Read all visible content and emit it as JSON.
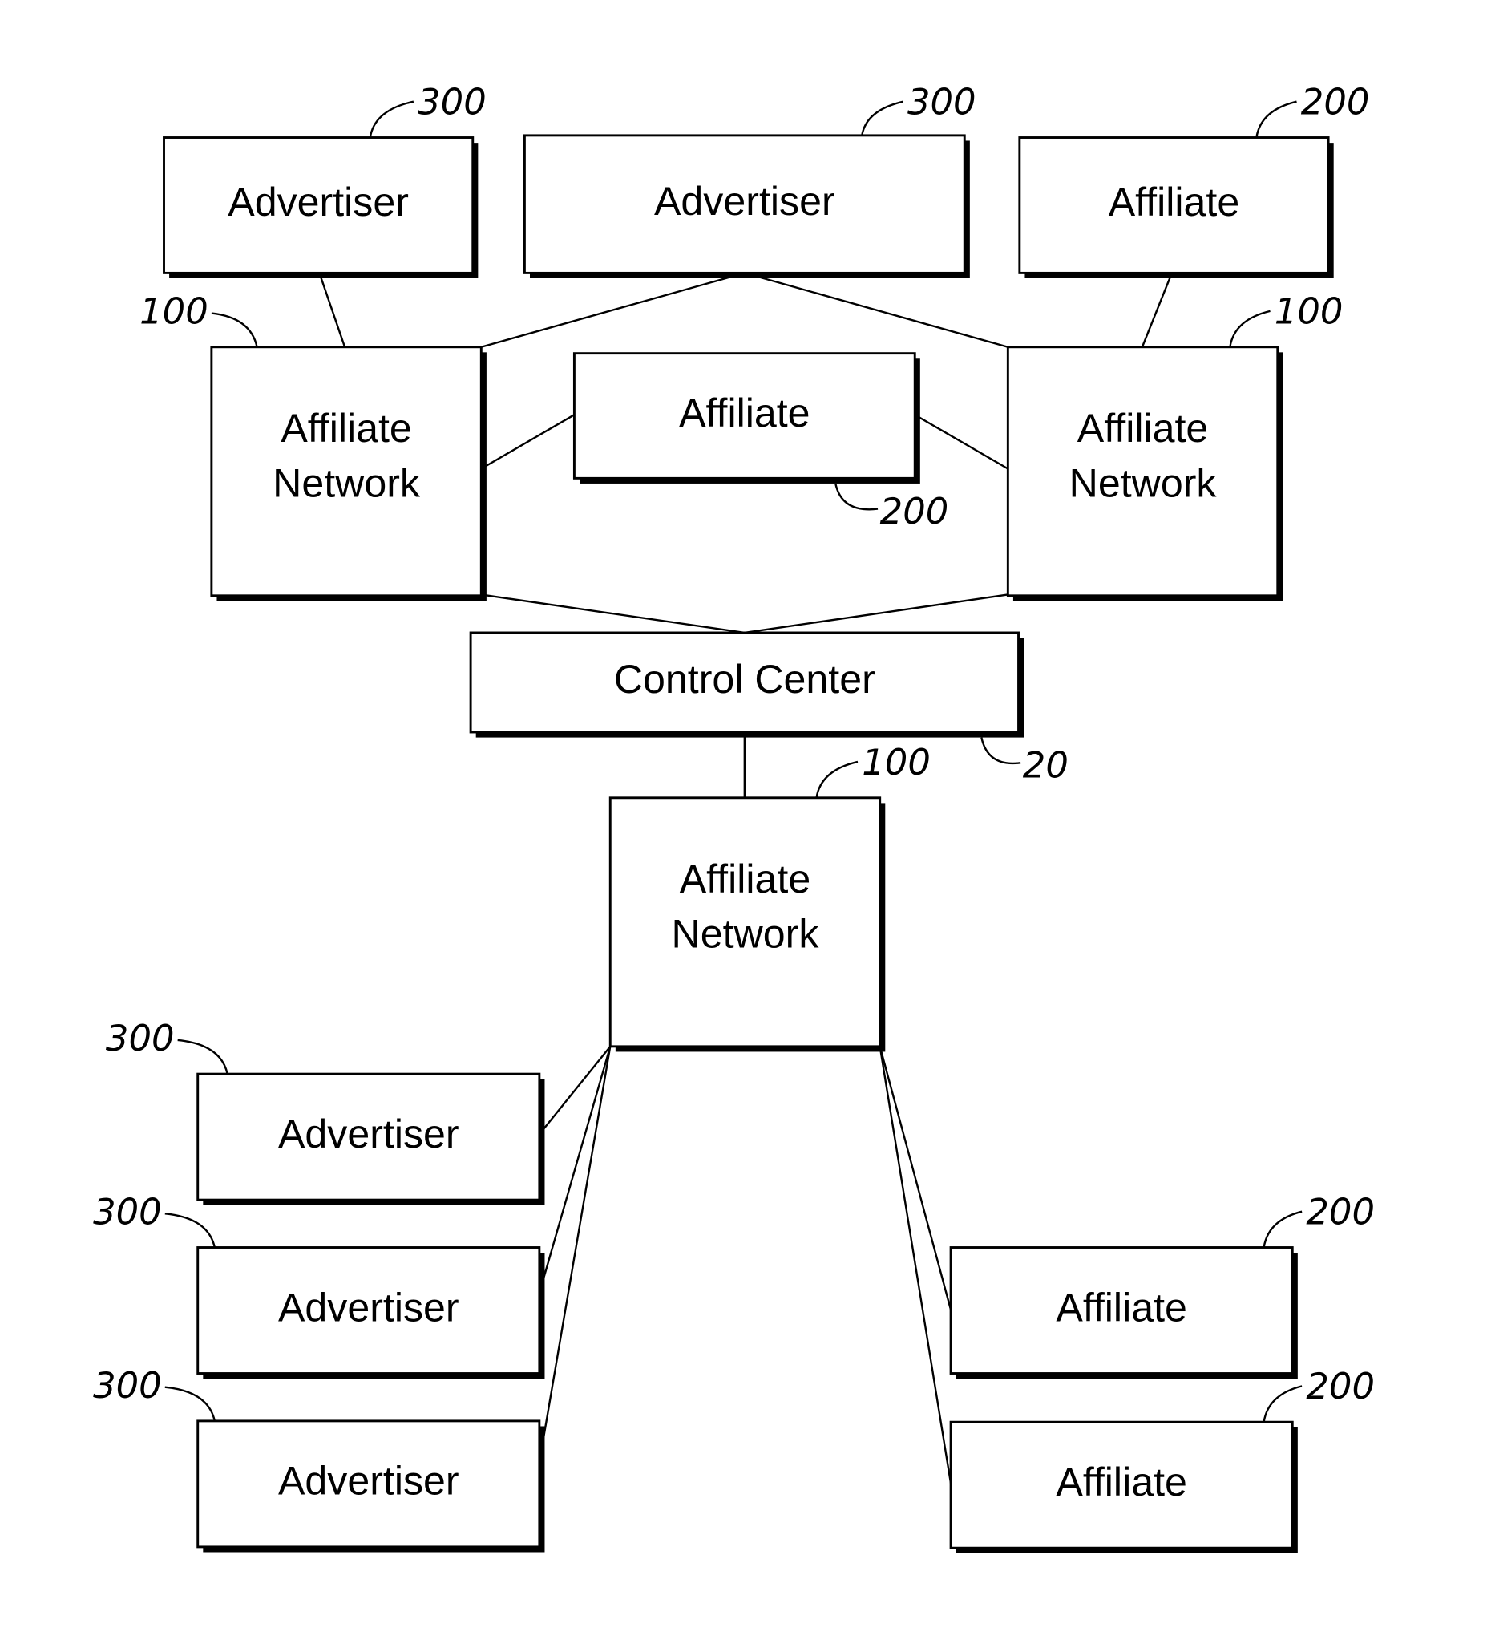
{
  "diagram": {
    "type": "network-block-diagram",
    "nodes": [
      {
        "id": "adv_top_left",
        "label": "Advertiser",
        "ref": "300"
      },
      {
        "id": "adv_top_mid",
        "label": "Advertiser",
        "ref": "300"
      },
      {
        "id": "aff_top_right",
        "label": "Affiliate",
        "ref": "200"
      },
      {
        "id": "an_left",
        "label": "Affiliate Network",
        "lines": [
          "Affiliate",
          "Network"
        ],
        "ref": "100"
      },
      {
        "id": "aff_mid",
        "label": "Affiliate",
        "ref": "200"
      },
      {
        "id": "an_right",
        "label": "Affiliate Network",
        "lines": [
          "Affiliate",
          "Network"
        ],
        "ref": "100"
      },
      {
        "id": "control_center",
        "label": "Control Center",
        "ref": "20"
      },
      {
        "id": "an_bottom",
        "label": "Affiliate Network",
        "lines": [
          "Affiliate",
          "Network"
        ],
        "ref": "100"
      },
      {
        "id": "adv_bottom_1",
        "label": "Advertiser",
        "ref": "300"
      },
      {
        "id": "adv_bottom_2",
        "label": "Advertiser",
        "ref": "300"
      },
      {
        "id": "adv_bottom_3",
        "label": "Advertiser",
        "ref": "300"
      },
      {
        "id": "aff_bottom_1",
        "label": "Affiliate",
        "ref": "200"
      },
      {
        "id": "aff_bottom_2",
        "label": "Affiliate",
        "ref": "200"
      }
    ],
    "edges": [
      [
        "adv_top_left",
        "an_left"
      ],
      [
        "adv_top_mid",
        "an_left"
      ],
      [
        "adv_top_mid",
        "an_right"
      ],
      [
        "aff_top_right",
        "an_right"
      ],
      [
        "an_left",
        "aff_mid"
      ],
      [
        "aff_mid",
        "an_right"
      ],
      [
        "an_left",
        "control_center"
      ],
      [
        "an_right",
        "control_center"
      ],
      [
        "control_center",
        "an_bottom"
      ],
      [
        "an_bottom",
        "adv_bottom_1"
      ],
      [
        "an_bottom",
        "adv_bottom_2"
      ],
      [
        "an_bottom",
        "adv_bottom_3"
      ],
      [
        "an_bottom",
        "aff_bottom_1"
      ],
      [
        "an_bottom",
        "aff_bottom_2"
      ]
    ]
  }
}
